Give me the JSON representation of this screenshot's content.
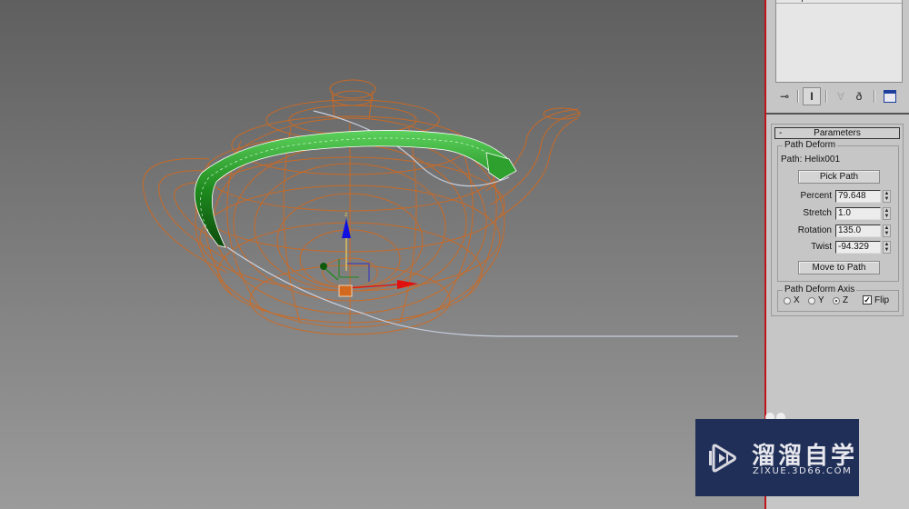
{
  "viewport": {
    "name": "Perspective viewport",
    "objects": [
      {
        "name": "Teapot001",
        "render": "wireframe",
        "color": "#d2691e"
      },
      {
        "name": "Tube (path-deformed)",
        "render": "shaded",
        "color": "#1e8c1e"
      },
      {
        "name": "Helix001",
        "render": "spline",
        "color": "#c8d0e0"
      }
    ],
    "gizmo": {
      "axes": [
        {
          "label": "x",
          "color": "#e01010"
        },
        {
          "label": "y",
          "color": "#1a8c1a"
        },
        {
          "label": "z",
          "color": "#1010e0"
        }
      ]
    }
  },
  "command_panel": {
    "stack_toolbar": {
      "buttons": [
        {
          "icon": "pin-stack-icon",
          "label": "Pin Stack"
        },
        {
          "icon": "show-end-result-icon",
          "label": "Show end result",
          "active": true
        },
        {
          "icon": "make-unique-icon",
          "label": "Make unique",
          "disabled": true
        },
        {
          "icon": "remove-modifier-icon",
          "label": "Remove modifier"
        },
        {
          "icon": "configure-modifier-sets-icon",
          "label": "Configure modifier sets"
        }
      ]
    },
    "rollout": {
      "title": "Parameters",
      "collapse_symbol": "-",
      "path_deform": {
        "group_label": "Path Deform",
        "path_label": "Path: Helix001",
        "pick_path_label": "Pick Path",
        "fields": [
          {
            "label": "Percent",
            "value": "79.648"
          },
          {
            "label": "Stretch",
            "value": "1.0"
          },
          {
            "label": "Rotation",
            "value": "135.0"
          },
          {
            "label": "Twist",
            "value": "-94.329"
          }
        ],
        "move_to_path_label": "Move to Path"
      },
      "axis_group": {
        "group_label": "Path Deform Axis",
        "options": [
          {
            "label": "X",
            "checked": false
          },
          {
            "label": "Y",
            "checked": false
          },
          {
            "label": "Z",
            "checked": true
          }
        ],
        "flip_label": "Flip",
        "flip_checked": true
      }
    }
  },
  "watermark": {
    "title": "溜溜自学",
    "url": "ZIXUE.3D66.COM",
    "bg_color": "#1f2f57"
  },
  "colors": {
    "divider": "#c0141c",
    "panel_bg": "#c6c6c6"
  }
}
